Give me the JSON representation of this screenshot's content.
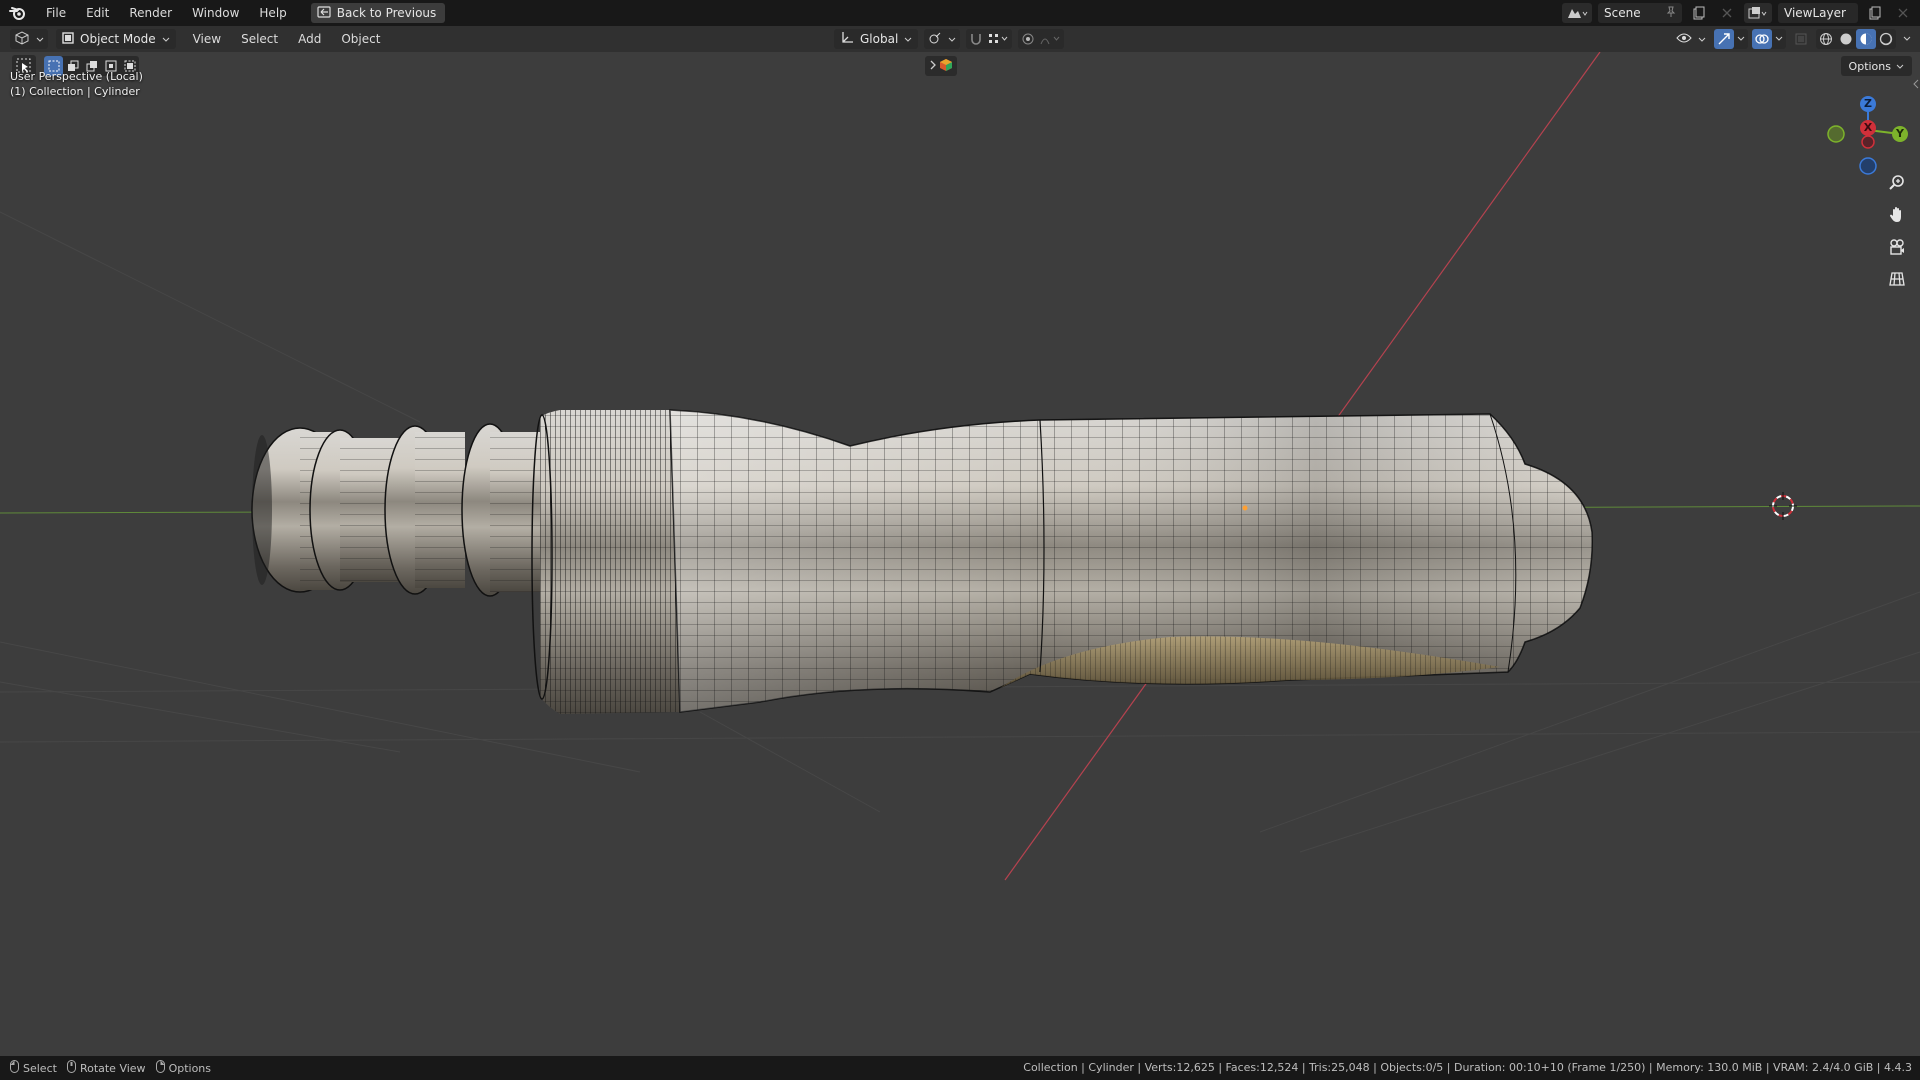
{
  "app": {
    "name": "Blender"
  },
  "topbar": {
    "menu": [
      "File",
      "Edit",
      "Render",
      "Window",
      "Help"
    ],
    "back_button": "Back to Previous",
    "scene_name": "Scene",
    "view_layer": "ViewLayer"
  },
  "viewport_header": {
    "mode": "Object Mode",
    "menu": [
      "View",
      "Select",
      "Add",
      "Object"
    ],
    "transform_orientation": "Global",
    "options_label": "Options"
  },
  "viewport": {
    "perspective_label": "User Perspective (Local)",
    "collection_label": "(1) Collection | Cylinder",
    "gizmo": {
      "x": "X",
      "y": "Y",
      "z": "Z"
    }
  },
  "statusbar": {
    "select": "Select",
    "rotate_view": "Rotate View",
    "options": "Options",
    "stats": "Collection | Cylinder | Verts:12,625 | Faces:12,524 | Tris:25,048 | Objects:0/5 | Duration: 00:10+10 (Frame 1/250) | Memory: 130.0 MiB | VRAM: 2.4/4.0 GiB | 4.4.3"
  },
  "colors": {
    "accent": "#4772b3",
    "axis_x": "#e0404f",
    "axis_y": "#8bc34a",
    "axis_z": "#3b7ad9",
    "viewport_bg": "#3d3d3d"
  }
}
